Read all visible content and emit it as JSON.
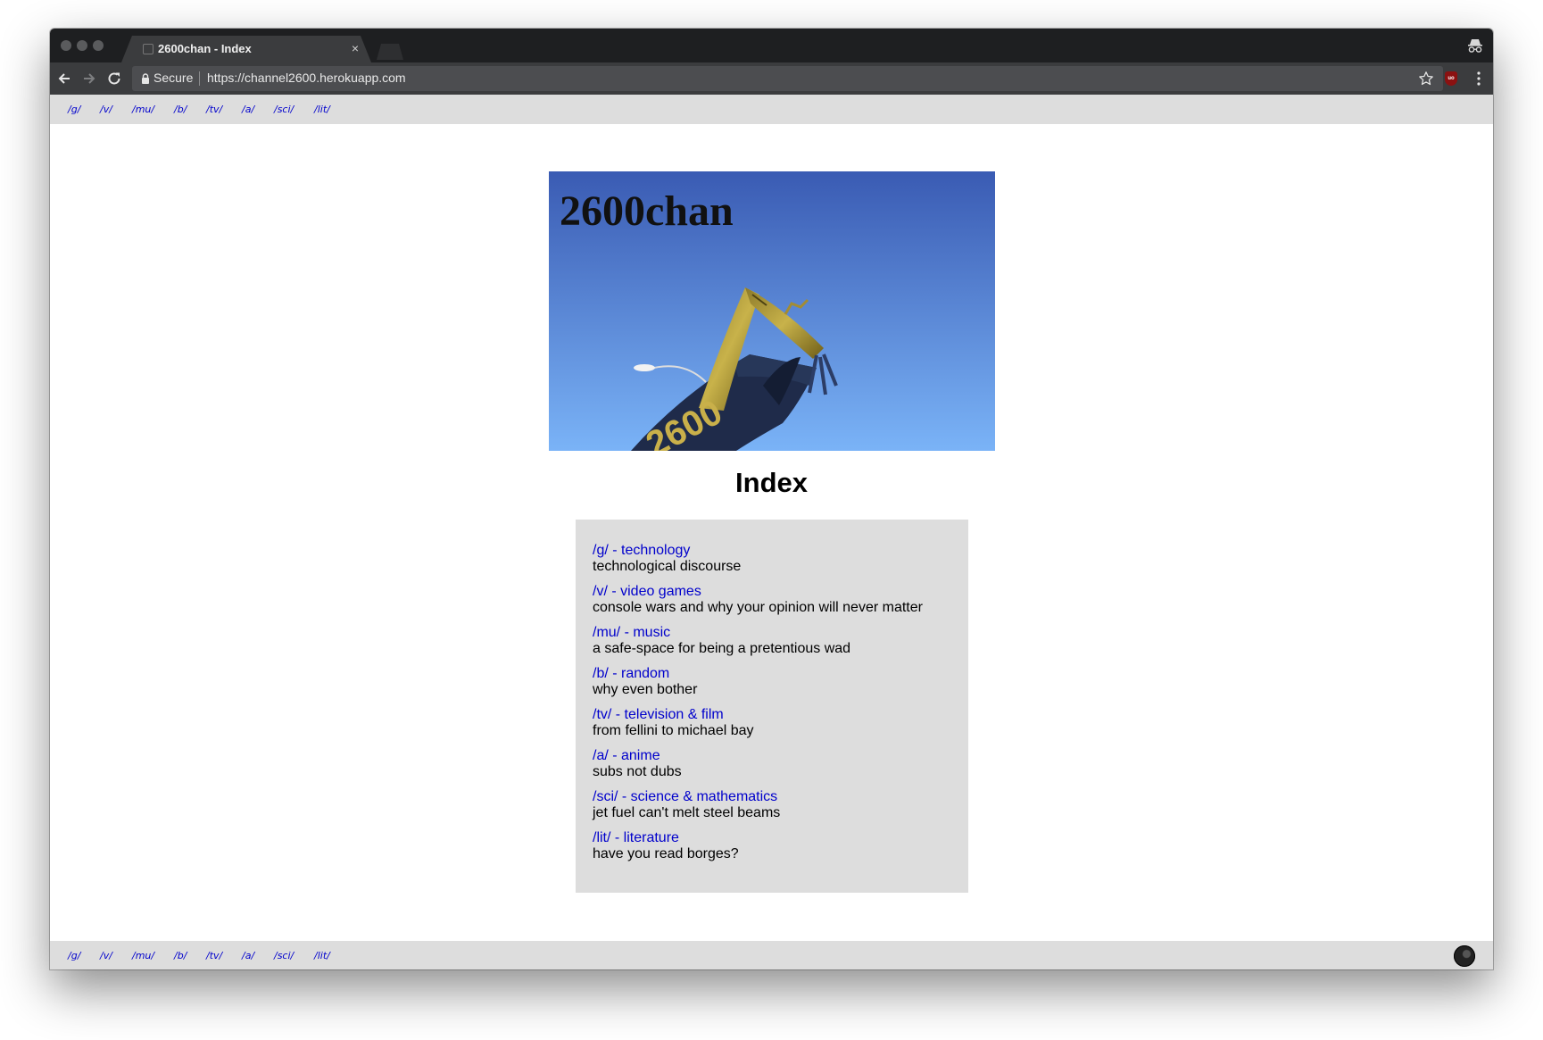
{
  "browser": {
    "tab_title": "2600chan - Index",
    "tab_close": "×",
    "secure_label": "Secure",
    "url": "https://channel2600.herokuapp.com",
    "extension_label": "uo"
  },
  "nav": {
    "boards": [
      "/g/",
      "/v/",
      "/mu/",
      "/b/",
      "/tv/",
      "/a/",
      "/sci/",
      "/lit/"
    ]
  },
  "banner": {
    "title": "2600chan",
    "figure_text": "2600"
  },
  "main": {
    "title": "Index",
    "boards": [
      {
        "link": "/g/ - technology",
        "desc": "technological discourse"
      },
      {
        "link": "/v/ - video games",
        "desc": "console wars and why your opinion will never matter"
      },
      {
        "link": "/mu/ - music",
        "desc": "a safe-space for being a pretentious wad"
      },
      {
        "link": "/b/ - random",
        "desc": "why even bother"
      },
      {
        "link": "/tv/ - television & film",
        "desc": "from fellini to michael bay"
      },
      {
        "link": "/a/ - anime",
        "desc": "subs not dubs"
      },
      {
        "link": "/sci/ - science & mathematics",
        "desc": "jet fuel can't melt steel beams"
      },
      {
        "link": "/lit/ - literature",
        "desc": "have you read borges?"
      }
    ]
  },
  "colors": {
    "link": "#0000cc",
    "nav_bar": "#dddddd",
    "chrome_dark": "#1e1f21",
    "chrome_toolbar": "#3b3c3e",
    "sky_top": "#3a5bb3",
    "sky_bottom": "#7ab3f7"
  },
  "icons": [
    "back-arrow-icon",
    "forward-arrow-icon",
    "reload-icon",
    "lock-icon",
    "star-icon",
    "ublock-icon",
    "menu-icon",
    "incognito-icon"
  ]
}
